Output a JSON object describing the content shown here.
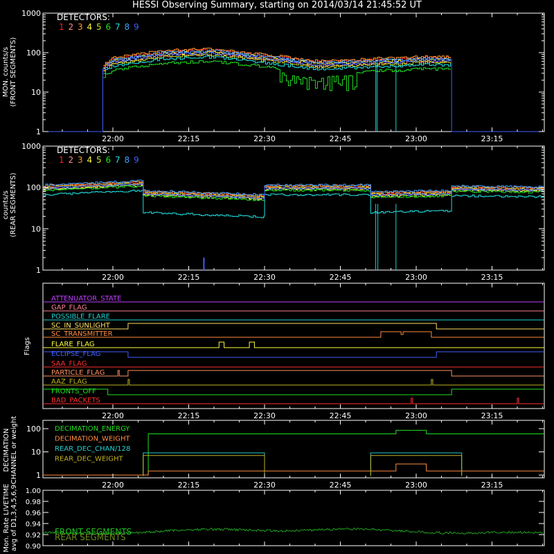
{
  "title": "HESSI Observing Summary, starting on 2014/03/14 21:45:52 UT",
  "time_ticks": [
    "22:00",
    "22:15",
    "22:30",
    "22:45",
    "23:00",
    "23:15"
  ],
  "detectors": {
    "label": "DETECTORS:",
    "numbers": [
      "1",
      "2",
      "3",
      "4",
      "5",
      "6",
      "7",
      "8",
      "9"
    ],
    "colors": [
      "#ff2020",
      "#ff8c8c",
      "#ff9933",
      "#ffff40",
      "#c8e020",
      "#20e020",
      "#20e0e0",
      "#40a0ff",
      "#4060ff"
    ]
  },
  "chart_data": [
    {
      "type": "line",
      "panel": "front",
      "ylabel": [
        "MON. counts/s",
        "(FRONT SEGMENTS)"
      ],
      "yscale": "log",
      "ylim": [
        1,
        1000
      ],
      "yticks": [
        "1",
        "10",
        "100",
        "1000"
      ],
      "xlabels": "time_ticks",
      "series_note": "detector count rates, 9 detectors",
      "profile_x": [
        "21:58",
        "22:00",
        "22:10",
        "22:20",
        "22:30",
        "22:40",
        "22:50",
        "22:53",
        "22:57",
        "23:00",
        "23:08"
      ],
      "profile_y": [
        45,
        65,
        100,
        110,
        80,
        55,
        60,
        65,
        65,
        70,
        70
      ]
    },
    {
      "type": "line",
      "panel": "rear",
      "ylabel": [
        "counts/s",
        "(REAR SEGMENTS)"
      ],
      "yscale": "log",
      "ylim": [
        1,
        1000
      ],
      "yticks": [
        "1",
        "10",
        "100",
        "1000"
      ],
      "xlabels": "time_ticks"
    },
    {
      "type": "line",
      "panel": "flags",
      "ylabel": [
        "Flags"
      ],
      "flags": [
        {
          "name": "ATTENUATOR_STATE",
          "color": "#c040ff"
        },
        {
          "name": "GAP_FLAG",
          "color": "#ff8090"
        },
        {
          "name": "POSSIBLE_FLARE",
          "color": "#20d0d0"
        },
        {
          "name": "SC_IN_SUNLIGHT",
          "color": "#ffe060"
        },
        {
          "name": "SC_TRANSMITTER",
          "color": "#ff8c40"
        },
        {
          "name": "FLARE_FLAG",
          "color": "#ffff40"
        },
        {
          "name": "ECLIPSE_FLAG",
          "color": "#4060ff"
        },
        {
          "name": "SAA_FLAG",
          "color": "#ff3030"
        },
        {
          "name": "PARTICLE_FLAG",
          "color": "#ff9060"
        },
        {
          "name": "AAZ_FLAG",
          "color": "#c0b020"
        },
        {
          "name": "FRONTS_OFF",
          "color": "#20e020"
        },
        {
          "name": "BAD_PACKETS",
          "color": "#ff3030"
        }
      ]
    },
    {
      "type": "line",
      "panel": "decimation",
      "ylabel": [
        "DECIMATION",
        "CHANNEL or weight"
      ],
      "yscale": "log",
      "yticks": [
        "1",
        "10",
        "100"
      ],
      "legend": [
        {
          "name": "DECIMATION_ENERGY",
          "color": "#20e020"
        },
        {
          "name": "DECIMATION_WEIGHT",
          "color": "#ff8c40"
        },
        {
          "name": "REAR_DEC_CHAN/128",
          "color": "#20d0d0"
        },
        {
          "name": "REAR_DEC_WEIGHT",
          "color": "#c0b020"
        }
      ]
    },
    {
      "type": "line",
      "panel": "livetime",
      "ylabel": [
        "Mon. Rate LIVETIME",
        "avg of D1,3,4,5,6,9"
      ],
      "ylim": [
        0.9,
        1.0
      ],
      "yticks": [
        "0.90",
        "0.92",
        "0.94",
        "0.96",
        "0.98",
        "1.00"
      ],
      "legend": [
        {
          "name": "FRONT SEGMENTS",
          "color": "#20c020"
        },
        {
          "name": "REAR SEGMENTS",
          "color": "#6a8a1a"
        }
      ]
    }
  ]
}
